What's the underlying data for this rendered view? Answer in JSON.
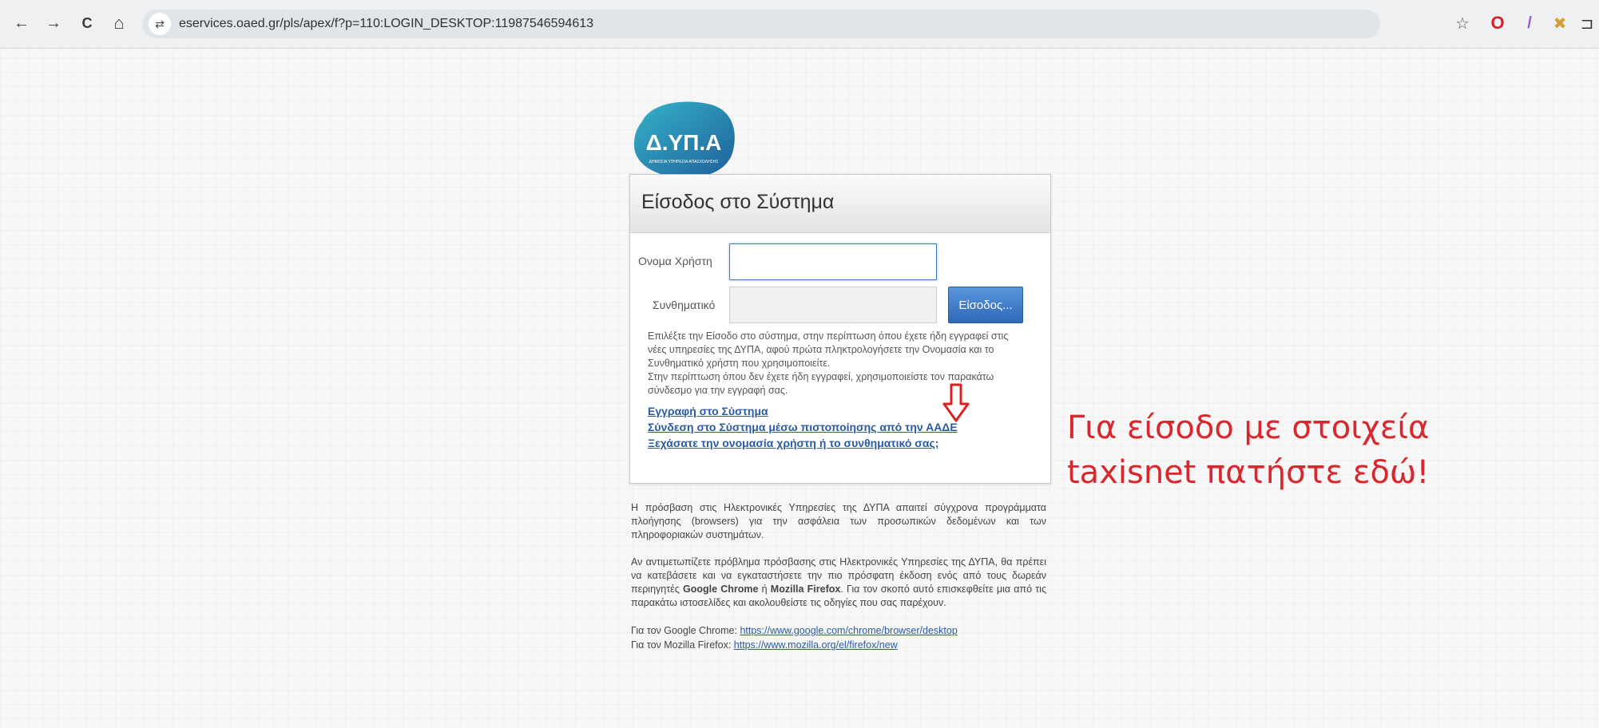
{
  "browser": {
    "url": "eservices.oaed.gr/pls/apex/f?p=110:LOGIN_DESKTOP:11987546594613",
    "back_icon": "←",
    "forward_icon": "→",
    "reload_icon": "C",
    "home_icon": "⌂",
    "site_info_icon": "⇄",
    "bookmark_icon": "☆",
    "ext_icons": [
      "O",
      "/",
      "✖",
      "⊐"
    ]
  },
  "logo": {
    "text": "Δ.ΥΠ.Α",
    "subtext": "ΔΗΜΟΣΙΑ ΥΠΗΡΕΣΙΑ ΑΠΑΣΧΟΛΗΣΗΣ"
  },
  "login": {
    "title": "Είσοδος στο Σύστημα",
    "username_label": "Ονομα Χρήστη",
    "password_label": "Συνθηματικό",
    "username_value": "",
    "password_value": "",
    "submit_label": "Είσοδος...",
    "desc_1": "Επιλέξτε την Είσοδο στο σύστημα, στην περίπτωση όπου έχετε ήδη εγγραφεί στις νέες υπηρεσίες της ΔΥΠΑ, αφού πρώτα πληκτρολογήσετε την Ονομασία και το Συνθηματικό χρήστη που χρησιμοποιείτε.",
    "desc_2": "Στην περίπτωση όπου δεν έχετε ήδη εγγραφεί, χρησιμοποιείστε τον παρακάτω σύνδεσμο για την εγγραφή σας.",
    "links": {
      "register": "Εγγραφή στο Σύστημα",
      "aade": "Σύνδεση στο Σύστημα μέσω πιστοποίησης από την ΑΑΔΕ",
      "forgot": "Ξεχάσατε την ονομασία χρήστη ή το συνθηματικό σας;"
    }
  },
  "callout": {
    "line1": "Για είσοδο με στοιχεία",
    "line2": "taxisnet πατήστε εδώ!",
    "color": "#d7282f"
  },
  "info": {
    "p1": "Η πρόσβαση στις Ηλεκτρονικές Υπηρεσίες της ΔΥΠΑ απαιτεί σύγχρονα προγράμματα πλοήγησης (browsers) για την ασφάλεια των προσωπικών δεδομένων και των πληροφοριακών συστημάτων.",
    "p2_a": "Αν αντιμετωπίζετε πρόβλημα πρόσβασης στις Ηλεκτρονικές Υπηρεσίες της ΔΥΠΑ, θα πρέπει να κατεβάσετε και να εγκαταστήσετε την πιο πρόσφατη έκδοση ενός από τους δωρεάν περιηγητές ",
    "p2_chrome": "Google Chrome",
    "p2_or": " ή ",
    "p2_firefox": "Mozilla Firefox",
    "p2_b": ". Για τον σκοπό αυτό επισκεφθείτε μια από τις παρακάτω ιστοσελίδες και ακολουθείστε τις οδηγίες που σας παρέχουν.",
    "chrome_label": "Για τον Google Chrome: ",
    "chrome_url": "https://www.google.com/chrome/browser/desktop",
    "firefox_label": "Για τον Mozilla Firefox: ",
    "firefox_url": "https://www.mozilla.org/el/firefox/new"
  }
}
